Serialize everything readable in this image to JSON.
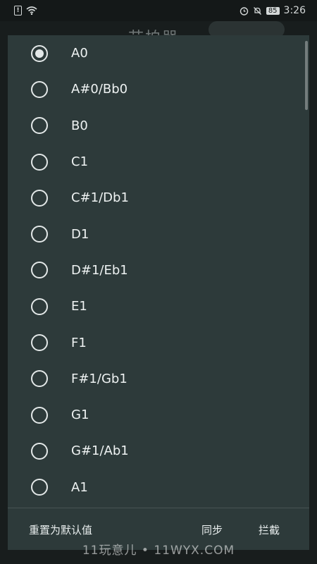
{
  "status_bar": {
    "time": "3:26",
    "battery": "85",
    "alert_glyph": "!",
    "icons": [
      "sim-alert-icon",
      "wifi-icon",
      "alarm-icon",
      "mute-icon",
      "battery-icon"
    ]
  },
  "background": {
    "title": "节拍器"
  },
  "dialog": {
    "options": [
      {
        "label": "A0",
        "selected": true
      },
      {
        "label": "A#0/Bb0",
        "selected": false
      },
      {
        "label": "B0",
        "selected": false
      },
      {
        "label": "C1",
        "selected": false
      },
      {
        "label": "C#1/Db1",
        "selected": false
      },
      {
        "label": "D1",
        "selected": false
      },
      {
        "label": "D#1/Eb1",
        "selected": false
      },
      {
        "label": "E1",
        "selected": false
      },
      {
        "label": "F1",
        "selected": false
      },
      {
        "label": "F#1/Gb1",
        "selected": false
      },
      {
        "label": "G1",
        "selected": false
      },
      {
        "label": "G#1/Ab1",
        "selected": false
      },
      {
        "label": "A1",
        "selected": false
      }
    ],
    "buttons": {
      "reset": "重置为默认值",
      "sync": "同步",
      "intercept": "拦截"
    }
  },
  "watermark": "11玩意儿 • 11WYX.COM",
  "colors": {
    "dialog_bg": "#2d3a3a",
    "screen_bg": "#181d1d",
    "text": "#eef2f2"
  }
}
